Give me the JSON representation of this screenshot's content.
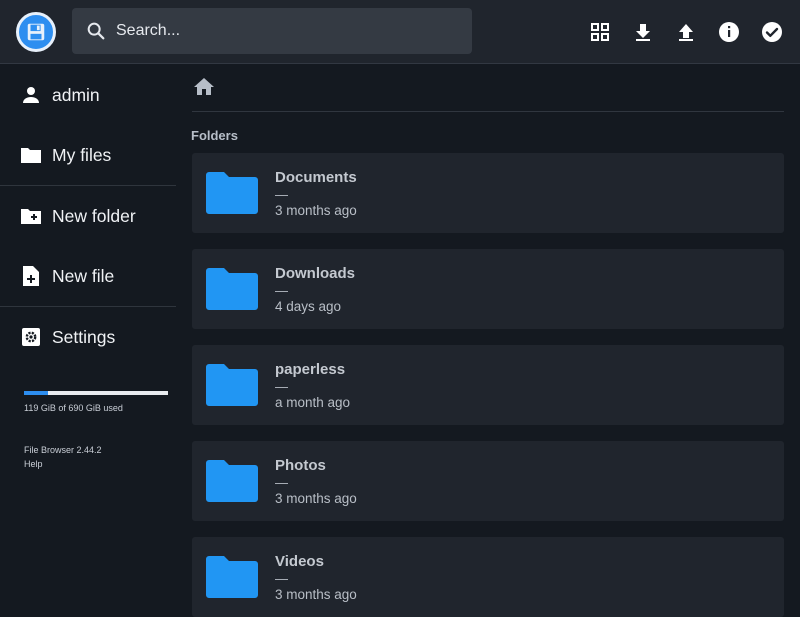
{
  "header": {
    "search_placeholder": "Search...",
    "actions": [
      "grid-view-icon",
      "download-icon",
      "upload-icon",
      "info-icon",
      "select-all-icon"
    ]
  },
  "sidebar": {
    "user": "admin",
    "my_files": "My files",
    "new_folder": "New folder",
    "new_file": "New file",
    "settings": "Settings",
    "quota_used_fraction": 0.17,
    "quota_text": "119 GiB of 690 GiB used",
    "version": "File Browser 2.44.2",
    "help": "Help"
  },
  "main": {
    "section_title": "Folders",
    "folders": [
      {
        "name": "Documents",
        "size": "—",
        "modified": "3 months ago"
      },
      {
        "name": "Downloads",
        "size": "—",
        "modified": "4 days ago"
      },
      {
        "name": "paperless",
        "size": "—",
        "modified": "a month ago"
      },
      {
        "name": "Photos",
        "size": "—",
        "modified": "3 months ago"
      },
      {
        "name": "Videos",
        "size": "—",
        "modified": "3 months ago"
      }
    ]
  },
  "colors": {
    "accent": "#2d8ef0",
    "folder_icon": "#2196f3",
    "background": "#141920",
    "surface": "#20252d"
  }
}
